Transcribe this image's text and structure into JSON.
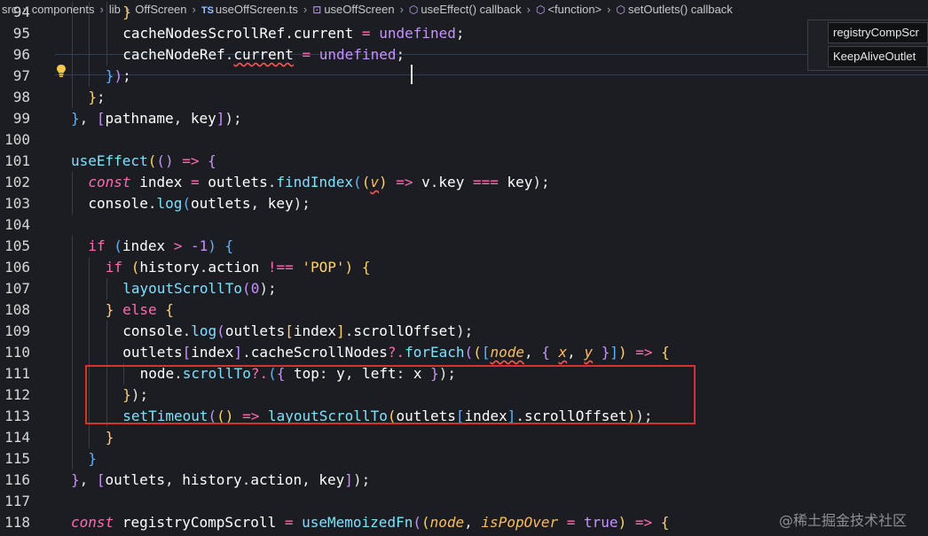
{
  "breadcrumb": {
    "items": [
      "src",
      "components",
      "lib",
      "OffScreen",
      "useOffScreen.ts",
      "useOffScreen",
      "useEffect() callback",
      "<function>",
      "setOutlets() callback"
    ],
    "ts_badge": "TS"
  },
  "outline": {
    "items": [
      "registryCompScr",
      "KeepAliveOutlet"
    ]
  },
  "watermark": "@稀土掘金技术社区",
  "code_lines": [
    {
      "num": "94",
      "indent": 3,
      "tokens": [
        [
          "}",
          "b2"
        ]
      ]
    },
    {
      "num": "95",
      "indent": 3,
      "tokens": [
        [
          "cacheNodesScrollRef",
          "v"
        ],
        [
          ".",
          "pc"
        ],
        [
          "current",
          "v"
        ],
        [
          " = ",
          "k"
        ],
        [
          "undefined",
          "u"
        ],
        [
          ";",
          "pc"
        ]
      ]
    },
    {
      "num": "96",
      "indent": 3,
      "tokens": [
        [
          "cacheNodeRef",
          "v"
        ],
        [
          ".",
          "pc"
        ],
        [
          "current",
          "v squig"
        ],
        [
          " = ",
          "k"
        ],
        [
          "undefined",
          "u"
        ],
        [
          ";",
          "pc"
        ]
      ]
    },
    {
      "num": "97",
      "indent": 2,
      "tokens": [
        [
          "}",
          "b3"
        ],
        [
          ")",
          "b1"
        ],
        [
          ";",
          "pc"
        ]
      ]
    },
    {
      "num": "98",
      "indent": 1,
      "tokens": [
        [
          "}",
          "b2"
        ],
        [
          ";",
          "pc"
        ]
      ]
    },
    {
      "num": "99",
      "indent": 0,
      "tokens": [
        [
          "}",
          "b3"
        ],
        [
          ", ",
          "pc"
        ],
        [
          "[",
          "b1"
        ],
        [
          "pathname",
          "v"
        ],
        [
          ", ",
          "pc"
        ],
        [
          "key",
          "v"
        ],
        [
          "]",
          "b1"
        ],
        [
          ");",
          "pc"
        ]
      ]
    },
    {
      "num": "100",
      "indent": 0,
      "tokens": []
    },
    {
      "num": "101",
      "indent": 0,
      "tokens": [
        [
          "useEffect",
          "f"
        ],
        [
          "(",
          "b2"
        ],
        [
          "(",
          "b1"
        ],
        [
          ")",
          "b1"
        ],
        [
          " => ",
          "k"
        ],
        [
          "{",
          "b1"
        ]
      ]
    },
    {
      "num": "102",
      "indent": 1,
      "tokens": [
        [
          "const",
          "k ital"
        ],
        [
          " index ",
          "v"
        ],
        [
          "= ",
          "k"
        ],
        [
          "outlets",
          "v"
        ],
        [
          ".",
          "pc"
        ],
        [
          "findIndex",
          "f"
        ],
        [
          "(",
          "b3"
        ],
        [
          "(",
          "b2"
        ],
        [
          "v",
          "pi squig"
        ],
        [
          ")",
          "b2"
        ],
        [
          " => ",
          "k"
        ],
        [
          "v",
          "v"
        ],
        [
          ".",
          "pc"
        ],
        [
          "key",
          "v"
        ],
        [
          " === ",
          "k"
        ],
        [
          "key",
          "v"
        ],
        [
          ");",
          "pc"
        ]
      ]
    },
    {
      "num": "103",
      "indent": 1,
      "tokens": [
        [
          "console",
          "v"
        ],
        [
          ".",
          "pc"
        ],
        [
          "log",
          "f"
        ],
        [
          "(",
          "b3"
        ],
        [
          "outlets",
          "v"
        ],
        [
          ", ",
          "pc"
        ],
        [
          "key",
          "v"
        ],
        [
          ");",
          "pc"
        ]
      ]
    },
    {
      "num": "104",
      "indent": 0,
      "tokens": []
    },
    {
      "num": "105",
      "indent": 1,
      "tokens": [
        [
          "if",
          "k"
        ],
        [
          " (",
          "b3"
        ],
        [
          "index",
          "v"
        ],
        [
          " > ",
          "k"
        ],
        [
          "-1",
          "n"
        ],
        [
          ") ",
          "b3"
        ],
        [
          "{",
          "b3"
        ]
      ]
    },
    {
      "num": "106",
      "indent": 2,
      "tokens": [
        [
          "if",
          "k"
        ],
        [
          " (",
          "b2"
        ],
        [
          "history",
          "v"
        ],
        [
          ".",
          "pc"
        ],
        [
          "action",
          "v"
        ],
        [
          " !== ",
          "k"
        ],
        [
          "'POP'",
          "s"
        ],
        [
          ") ",
          "b2"
        ],
        [
          "{",
          "b2"
        ]
      ]
    },
    {
      "num": "107",
      "indent": 3,
      "tokens": [
        [
          "layoutScrollTo",
          "f"
        ],
        [
          "(",
          "b1"
        ],
        [
          "0",
          "n"
        ],
        [
          ");",
          "pc"
        ]
      ]
    },
    {
      "num": "108",
      "indent": 2,
      "tokens": [
        [
          "}",
          "b2"
        ],
        [
          " else ",
          "k"
        ],
        [
          "{",
          "b2"
        ]
      ]
    },
    {
      "num": "109",
      "indent": 3,
      "tokens": [
        [
          "console",
          "v"
        ],
        [
          ".",
          "pc"
        ],
        [
          "log",
          "f"
        ],
        [
          "(",
          "b1"
        ],
        [
          "outlets",
          "v"
        ],
        [
          "[",
          "b2"
        ],
        [
          "index",
          "v"
        ],
        [
          "]",
          "b2"
        ],
        [
          ".",
          "pc"
        ],
        [
          "scrollOffset",
          "v"
        ],
        [
          ");",
          "pc"
        ]
      ]
    },
    {
      "num": "110",
      "indent": 3,
      "tokens": [
        [
          "outlets",
          "v"
        ],
        [
          "[",
          "b1"
        ],
        [
          "index",
          "v"
        ],
        [
          "]",
          "b1"
        ],
        [
          ".",
          "pc"
        ],
        [
          "cacheScrollNodes",
          "v"
        ],
        [
          "?.",
          "k"
        ],
        [
          "forEach",
          "f"
        ],
        [
          "(",
          "b1"
        ],
        [
          "(",
          "b2"
        ],
        [
          "[",
          "b3"
        ],
        [
          "node",
          "pi squig"
        ],
        [
          ", ",
          "pc"
        ],
        [
          "{ ",
          "b1"
        ],
        [
          "x",
          "pi squig"
        ],
        [
          ", ",
          "pc"
        ],
        [
          "y",
          "pi squig"
        ],
        [
          " }",
          "b1"
        ],
        [
          "]",
          "b3"
        ],
        [
          ")",
          "b2"
        ],
        [
          " => ",
          "k"
        ],
        [
          "{",
          "b2"
        ]
      ]
    },
    {
      "num": "111",
      "indent": 4,
      "tokens": [
        [
          "node",
          "v"
        ],
        [
          ".",
          "pc"
        ],
        [
          "scrollTo",
          "f"
        ],
        [
          "?.",
          "k"
        ],
        [
          "(",
          "b3"
        ],
        [
          "{ ",
          "b1"
        ],
        [
          "top",
          "v"
        ],
        [
          ": ",
          "pc"
        ],
        [
          "y",
          "v"
        ],
        [
          ", ",
          "pc"
        ],
        [
          "left",
          "v"
        ],
        [
          ": ",
          "pc"
        ],
        [
          "x",
          "v"
        ],
        [
          " }",
          "b1"
        ],
        [
          ");",
          "pc"
        ]
      ]
    },
    {
      "num": "112",
      "indent": 3,
      "tokens": [
        [
          "}",
          "b2"
        ],
        [
          ");",
          "pc"
        ]
      ]
    },
    {
      "num": "113",
      "indent": 3,
      "tokens": [
        [
          "setTimeout",
          "f"
        ],
        [
          "(",
          "b1"
        ],
        [
          "(",
          "b2"
        ],
        [
          ")",
          "b2"
        ],
        [
          " => ",
          "k"
        ],
        [
          "layoutScrollTo",
          "f"
        ],
        [
          "(",
          "b2"
        ],
        [
          "outlets",
          "v"
        ],
        [
          "[",
          "b3"
        ],
        [
          "index",
          "v"
        ],
        [
          "]",
          "b3"
        ],
        [
          ".",
          "pc"
        ],
        [
          "scrollOffset",
          "v"
        ],
        [
          ")",
          "b2"
        ],
        [
          ");",
          "pc"
        ]
      ]
    },
    {
      "num": "114",
      "indent": 2,
      "tokens": [
        [
          "}",
          "b2"
        ]
      ]
    },
    {
      "num": "115",
      "indent": 1,
      "tokens": [
        [
          "}",
          "b3"
        ]
      ]
    },
    {
      "num": "116",
      "indent": 0,
      "tokens": [
        [
          "}",
          "b1"
        ],
        [
          ", ",
          "pc"
        ],
        [
          "[",
          "b1"
        ],
        [
          "outlets",
          "v"
        ],
        [
          ", ",
          "pc"
        ],
        [
          "history",
          "v"
        ],
        [
          ".",
          "pc"
        ],
        [
          "action",
          "v"
        ],
        [
          ", ",
          "pc"
        ],
        [
          "key",
          "v"
        ],
        [
          "]",
          "b1"
        ],
        [
          ");",
          "pc"
        ]
      ]
    },
    {
      "num": "117",
      "indent": 0,
      "tokens": []
    },
    {
      "num": "118",
      "indent": 0,
      "tokens": [
        [
          "const",
          "k ital"
        ],
        [
          " ",
          "pc"
        ],
        [
          "registryCompScroll",
          "v"
        ],
        [
          " = ",
          "k"
        ],
        [
          "useMemoizedFn",
          "f"
        ],
        [
          "(",
          "b1"
        ],
        [
          "(",
          "b2"
        ],
        [
          "node",
          "pi"
        ],
        [
          ", ",
          "pc"
        ],
        [
          "isPopOver",
          "pi"
        ],
        [
          " = ",
          "k"
        ],
        [
          "true",
          "u"
        ],
        [
          ")",
          "b2"
        ],
        [
          " => ",
          "k"
        ],
        [
          "{",
          "b2"
        ]
      ]
    }
  ],
  "colors": {
    "background": "#1b1d23",
    "annotation_box": "#d8322e",
    "keyword": "#ff6bb0",
    "function": "#7ee0ff",
    "constant": "#c792ff",
    "string": "#ffd369"
  }
}
